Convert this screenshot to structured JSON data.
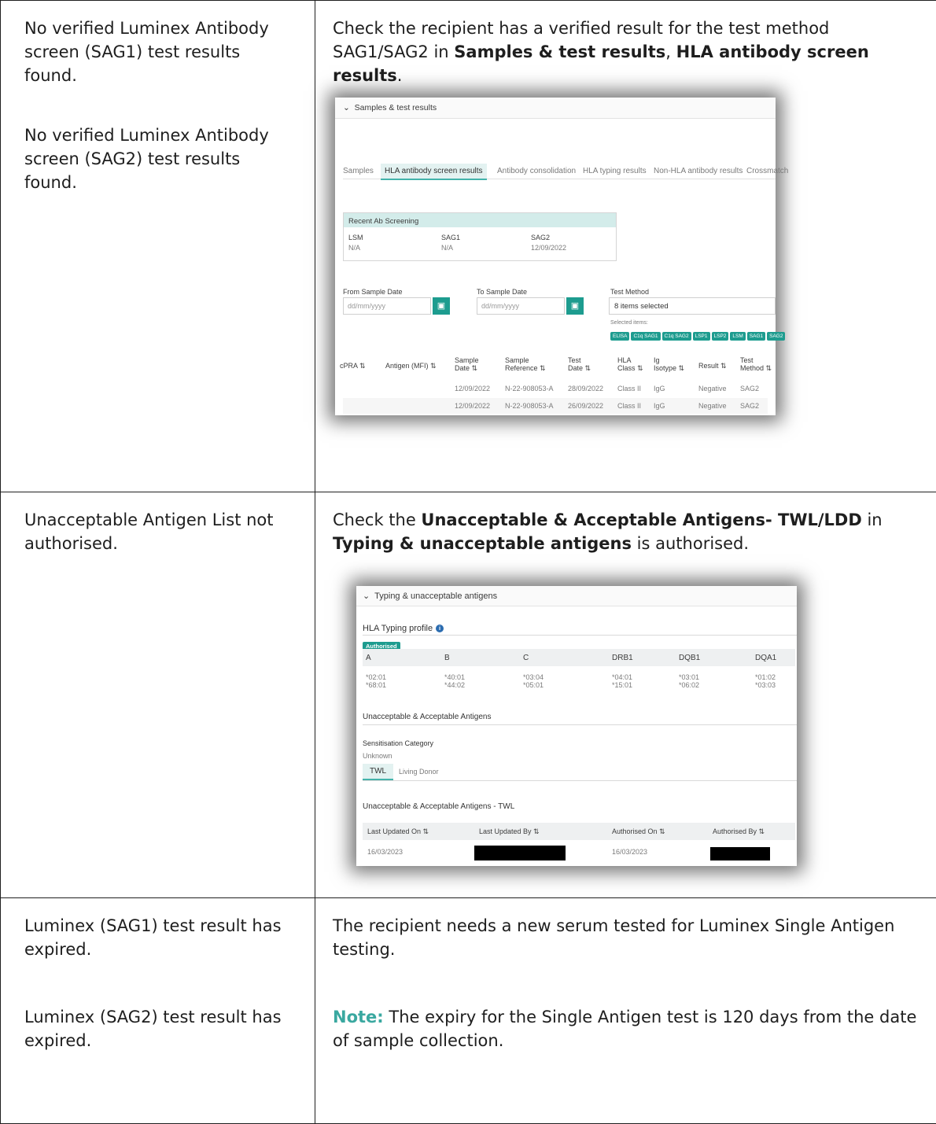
{
  "rows": [
    {
      "left": [
        "No verified Luminex Antibody screen (SAG1) test results found.",
        "No verified Luminex Antibody screen (SAG2) test results found."
      ],
      "right": {
        "p1": "Check the recipient has a verified result for the test method SAG1/SAG2 in ",
        "b1": "Samples & test results",
        "p2": ", ",
        "b2": "HLA antibody screen results",
        "p3": "."
      }
    },
    {
      "left": [
        "Unacceptable Antigen List not authorised."
      ],
      "right": {
        "p1": "Check the ",
        "b1": "Unacceptable & Acceptable Antigens- TWL/LDD",
        "p2": " in ",
        "b2": "Typing & unacceptable antigens",
        "p3": " is authorised."
      }
    },
    {
      "left": [
        "Luminex (SAG1) test result has expired.",
        "Luminex (SAG2) test result has expired."
      ],
      "right": {
        "p1": "The recipient needs a new serum tested for Luminex Single Antigen testing.",
        "note_label": "Note:",
        "note_text": " The expiry for the Single Antigen test is 120 days from the date of sample collection."
      }
    }
  ],
  "shot1": {
    "header": "Samples & test results",
    "tabs": [
      "Samples",
      "HLA antibody screen results",
      "Antibody consolidation",
      "HLA typing results",
      "Non-HLA antibody results",
      "Crossmatch"
    ],
    "recent": {
      "title": "Recent Ab Screening",
      "cols": [
        {
          "label": "LSM",
          "value": "N/A"
        },
        {
          "label": "SAG1",
          "value": "N/A"
        },
        {
          "label": "SAG2",
          "value": "12/09/2022"
        }
      ]
    },
    "from_label": "From Sample Date",
    "to_label": "To Sample Date",
    "date_placeholder": "dd/mm/yyyy",
    "method_label": "Test Method",
    "method_value": "8 items selected",
    "selected_label": "Selected items:",
    "chips": [
      "ELISA",
      "C1q SAG1",
      "C1q SAG2",
      "LSP1",
      "LSP2",
      "LSM",
      "SAG1",
      "SAG2"
    ],
    "columns": [
      [
        "cPRA ⇅"
      ],
      [
        "Antigen (MFI) ⇅"
      ],
      [
        "Sample",
        "Date ⇅"
      ],
      [
        "Sample",
        "Reference ⇅"
      ],
      [
        "Test",
        "Date ⇅"
      ],
      [
        "HLA",
        "Class ⇅"
      ],
      [
        "Ig",
        "Isotype ⇅"
      ],
      [
        "Result ⇅"
      ],
      [
        "Test",
        "Method ⇅"
      ]
    ],
    "rows": [
      [
        "12/09/2022",
        "N-22-908053-A",
        "28/09/2022",
        "Class II",
        "IgG",
        "Negative",
        "SAG2"
      ],
      [
        "12/09/2022",
        "N-22-908053-A",
        "26/09/2022",
        "Class II",
        "IgG",
        "Negative",
        "SAG2"
      ]
    ]
  },
  "shot2": {
    "header": "Typing & unacceptable antigens",
    "profile_title": "HLA Typing profile",
    "badge": "Authorised",
    "loci": [
      "A",
      "B",
      "C",
      "DRB1",
      "DQB1",
      "DQA1"
    ],
    "alleles1": [
      "*02:01",
      "*40:01",
      "*03:04",
      "*04:01",
      "*03:01",
      "*01:02"
    ],
    "alleles2": [
      "*68:01",
      "*44:02",
      "*05:01",
      "*15:01",
      "*06:02",
      "*03:03"
    ],
    "ua_title": "Unacceptable & Acceptable Antigens",
    "sens_label": "Sensitisation Category",
    "sens_value": "Unknown",
    "tab_twl": "TWL",
    "tab_living": "Living Donor",
    "twl_title": "Unacceptable & Acceptable Antigens - TWL",
    "cols": [
      "Last Updated On ⇅",
      "Last Updated By ⇅",
      "Authorised On ⇅",
      "Authorised By ⇅"
    ],
    "row": {
      "updated_on": "16/03/2023",
      "authorised_on": "16/03/2023"
    }
  }
}
